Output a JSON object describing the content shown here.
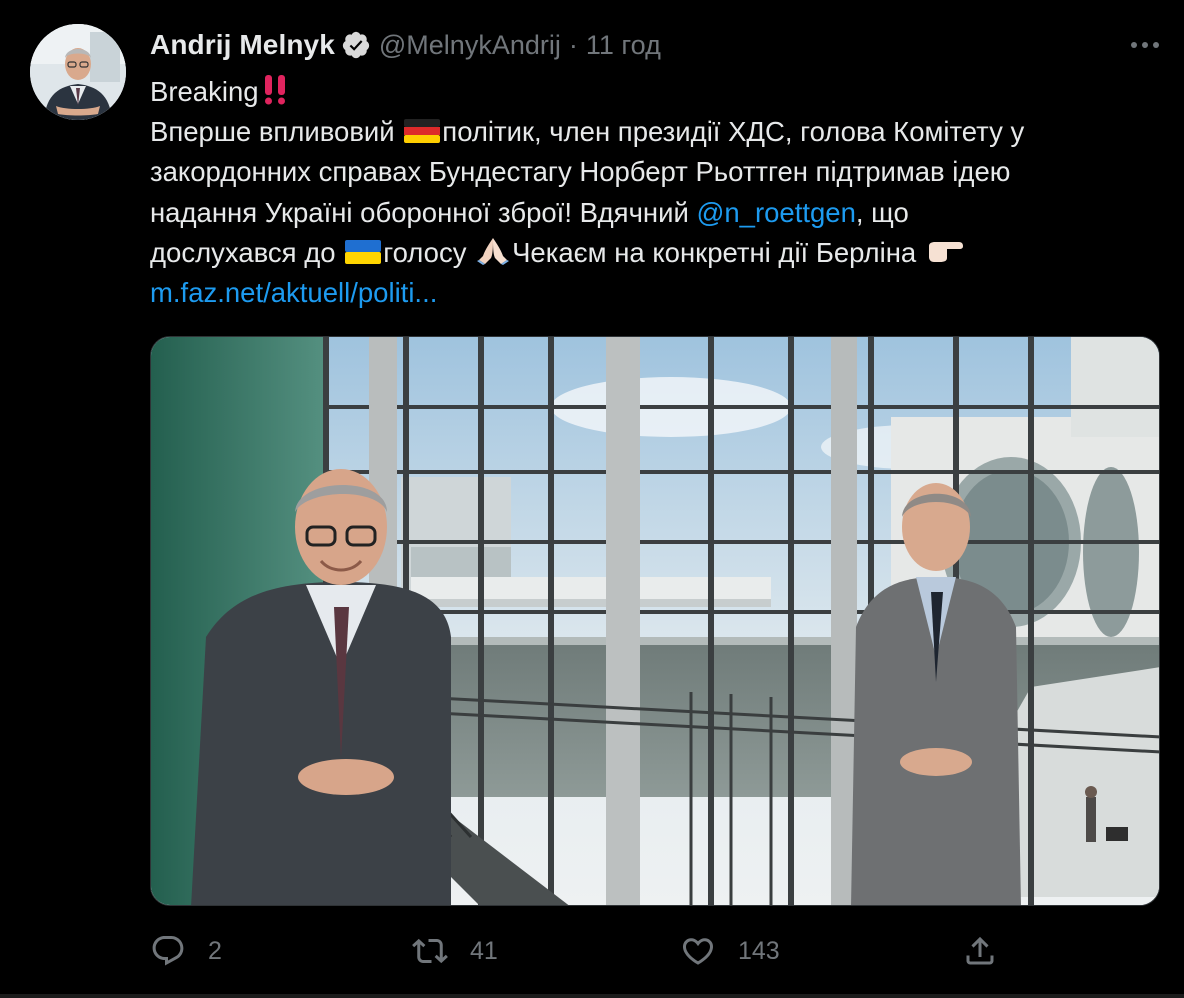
{
  "author": {
    "display_name": "Andrij Melnyk",
    "handle": "@MelnykAndrij",
    "separator": "·",
    "time": "11 год",
    "verified": true
  },
  "tweet": {
    "lines": [
      {
        "segments": [
          {
            "text": "Breaking"
          },
          {
            "emoji": "double-exclamation-icon"
          }
        ]
      },
      {
        "segments": [
          {
            "text": "Вперше впливовий "
          },
          {
            "emoji": "germany-flag-icon"
          },
          {
            "text": "політик, член президії ХДС, голова Комітету у"
          }
        ]
      },
      {
        "segments": [
          {
            "text": "закордонних справах Бундестагу Норберт Рьоттген підтримав ідею"
          }
        ]
      },
      {
        "segments": [
          {
            "text": "надання Україні оборонної зброї! Вдячний "
          },
          {
            "link": "@n_roettgen"
          },
          {
            "text": ", що"
          }
        ]
      },
      {
        "segments": [
          {
            "text": "дослухався до "
          },
          {
            "emoji": "ukraine-flag-icon"
          },
          {
            "text": "голосу "
          },
          {
            "emoji": "folded-hands-icon"
          },
          {
            "text": "Чекаєм на конкретні дії Берліна "
          },
          {
            "emoji": "pointing-right-icon"
          }
        ]
      },
      {
        "segments": [
          {
            "link": "m.faz.net/aktuell/politi..."
          }
        ]
      }
    ]
  },
  "media": {
    "kind": "photo"
  },
  "actions": {
    "reply": {
      "icon": "reply-icon",
      "count": "2"
    },
    "retweet": {
      "icon": "retweet-icon",
      "count": "41"
    },
    "like": {
      "icon": "heart-icon",
      "count": "143"
    },
    "share": {
      "icon": "share-icon"
    }
  },
  "colors": {
    "background": "#000000",
    "text": "#e7e9ea",
    "secondary": "#71767b",
    "link": "#1d9bf0",
    "verified": "#d9d9d9"
  }
}
